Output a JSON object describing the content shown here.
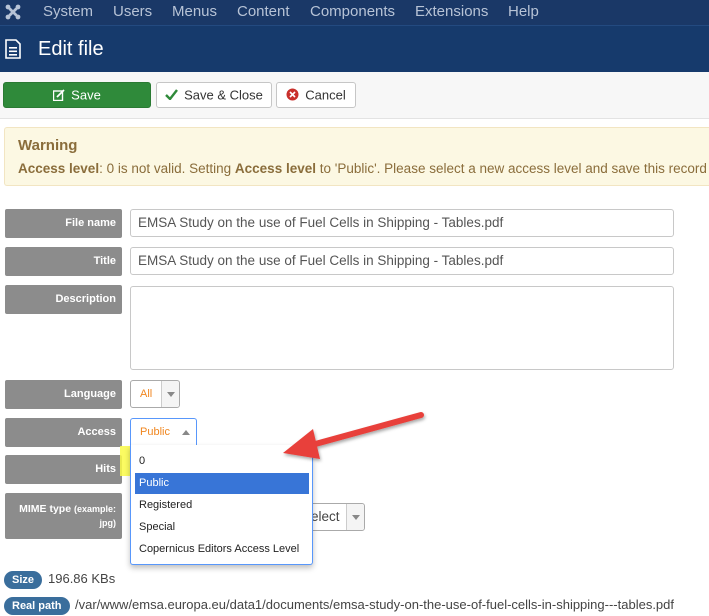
{
  "menu": {
    "items": [
      "System",
      "Users",
      "Menus",
      "Content",
      "Components",
      "Extensions",
      "Help"
    ]
  },
  "header": {
    "title": "Edit file"
  },
  "toolbar": {
    "save_label": "Save",
    "save_close_label": "Save & Close",
    "cancel_label": "Cancel"
  },
  "warning": {
    "title": "Warning",
    "message_parts": [
      "Access level",
      ": 0 is not valid. Setting ",
      "Access level",
      " to 'Public'. Please select a new access level and save this record"
    ]
  },
  "form": {
    "file_name_label": "File name",
    "file_name_value": "EMSA Study on the use of Fuel Cells in Shipping - Tables.pdf",
    "title_label": "Title",
    "title_value": "EMSA Study on the use of Fuel Cells in Shipping - Tables.pdf",
    "description_label": "Description",
    "language_label": "Language",
    "language_value": "All",
    "access_label": "Access",
    "access_value": "Public",
    "access_options": [
      "0",
      "Public",
      "Registered",
      "Special",
      "Copernicus Editors Access Level"
    ],
    "access_selected_option": "Public",
    "hits_label": "Hits",
    "mime_label": "MIME type",
    "mime_hint": "(example: jpg)",
    "mime_select_visible": "elect"
  },
  "meta": {
    "size_label": "Size",
    "size_value": "196.86 KBs",
    "real_path_label": "Real path",
    "real_path_value": "/var/www/emsa.europa.eu/data1/documents/emsa-study-on-the-use-of-fuel-cells-in-shipping---tables.pdf"
  },
  "colors": {
    "menu_bg": "#1a3867",
    "title_bg": "#163a6c",
    "save_green": "#2f8a3a",
    "warning_bg": "#fcf8e3",
    "label_gray": "#8c8c8c",
    "select_orange": "#f0861f",
    "dropdown_selected": "#3875d7",
    "highlight_yellow": "#fafa46",
    "annotation_arrow": "#e8403a"
  }
}
